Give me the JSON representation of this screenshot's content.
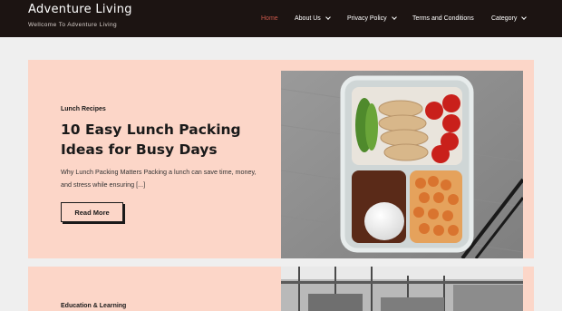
{
  "header": {
    "title": "Adventure Living",
    "tagline": "Wellcome To Adventure Living",
    "nav": [
      {
        "label": "Home"
      },
      {
        "label": "About Us"
      },
      {
        "label": "Privacy Policy"
      },
      {
        "label": "Terms and Conditions"
      },
      {
        "label": "Category"
      }
    ]
  },
  "posts": [
    {
      "category": "Lunch Recipes",
      "title": "10 Easy Lunch Packing Ideas for Busy Days",
      "excerpt": "Why Lunch Packing Matters Packing a lunch can save time, money, and stress while ensuring [...]",
      "read_more": "Read More"
    },
    {
      "category": "Education & Learning"
    }
  ],
  "colors": {
    "header_bg": "#1c1412",
    "active_nav": "#c8574a",
    "card_bg": "#fcd6c8",
    "page_bg": "#efefef"
  }
}
